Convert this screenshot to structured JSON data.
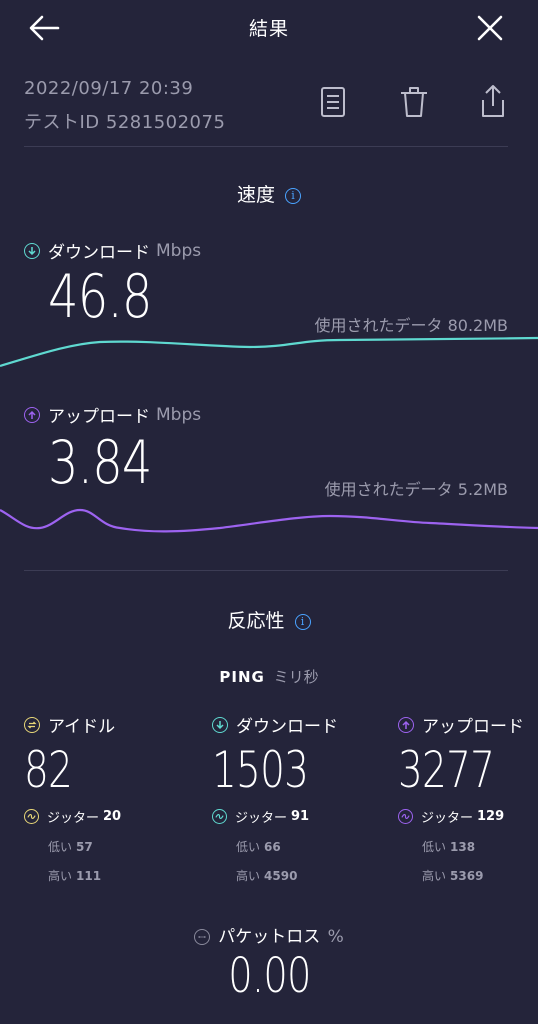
{
  "header": {
    "title": "結果",
    "back_icon": "arrow-left-icon",
    "close_icon": "close-icon"
  },
  "result": {
    "datetime": "2022/09/17 20:39",
    "test_id": "テストID 5281502075"
  },
  "toolbar": {
    "icons": [
      "document-icon",
      "trash-icon",
      "share-icon"
    ]
  },
  "speed": {
    "section_title": "速度",
    "download": {
      "label": "ダウンロード",
      "unit": "Mbps",
      "value": "46.8",
      "data_used": "使用されたデータ 80.2MB",
      "color": "#5fd9d0"
    },
    "upload": {
      "label": "アップロード",
      "unit": "Mbps",
      "value": "3.84",
      "data_used": "使用されたデータ 5.2MB",
      "color": "#9d63f0"
    }
  },
  "responsiveness": {
    "section_title": "反応性",
    "ping_label": "PING",
    "ping_unit": "ミリ秒",
    "columns": [
      {
        "label": "アイドル",
        "value": "82",
        "jitter_label": "ジッター",
        "jitter": "20",
        "low_label": "低い",
        "low": "57",
        "high_label": "高い",
        "high": "111",
        "color": "#e8d778"
      },
      {
        "label": "ダウンロード",
        "value": "1503",
        "jitter_label": "ジッター",
        "jitter": "91",
        "low_label": "低い",
        "low": "66",
        "high_label": "高い",
        "high": "4590",
        "color": "#5fd9d0"
      },
      {
        "label": "アップロード",
        "value": "3277",
        "jitter_label": "ジッター",
        "jitter": "129",
        "low_label": "低い",
        "low": "138",
        "high_label": "高い",
        "high": "5369",
        "color": "#9d63f0"
      }
    ]
  },
  "packet_loss": {
    "label": "パケットロス",
    "unit": "%",
    "value": "0.00"
  }
}
